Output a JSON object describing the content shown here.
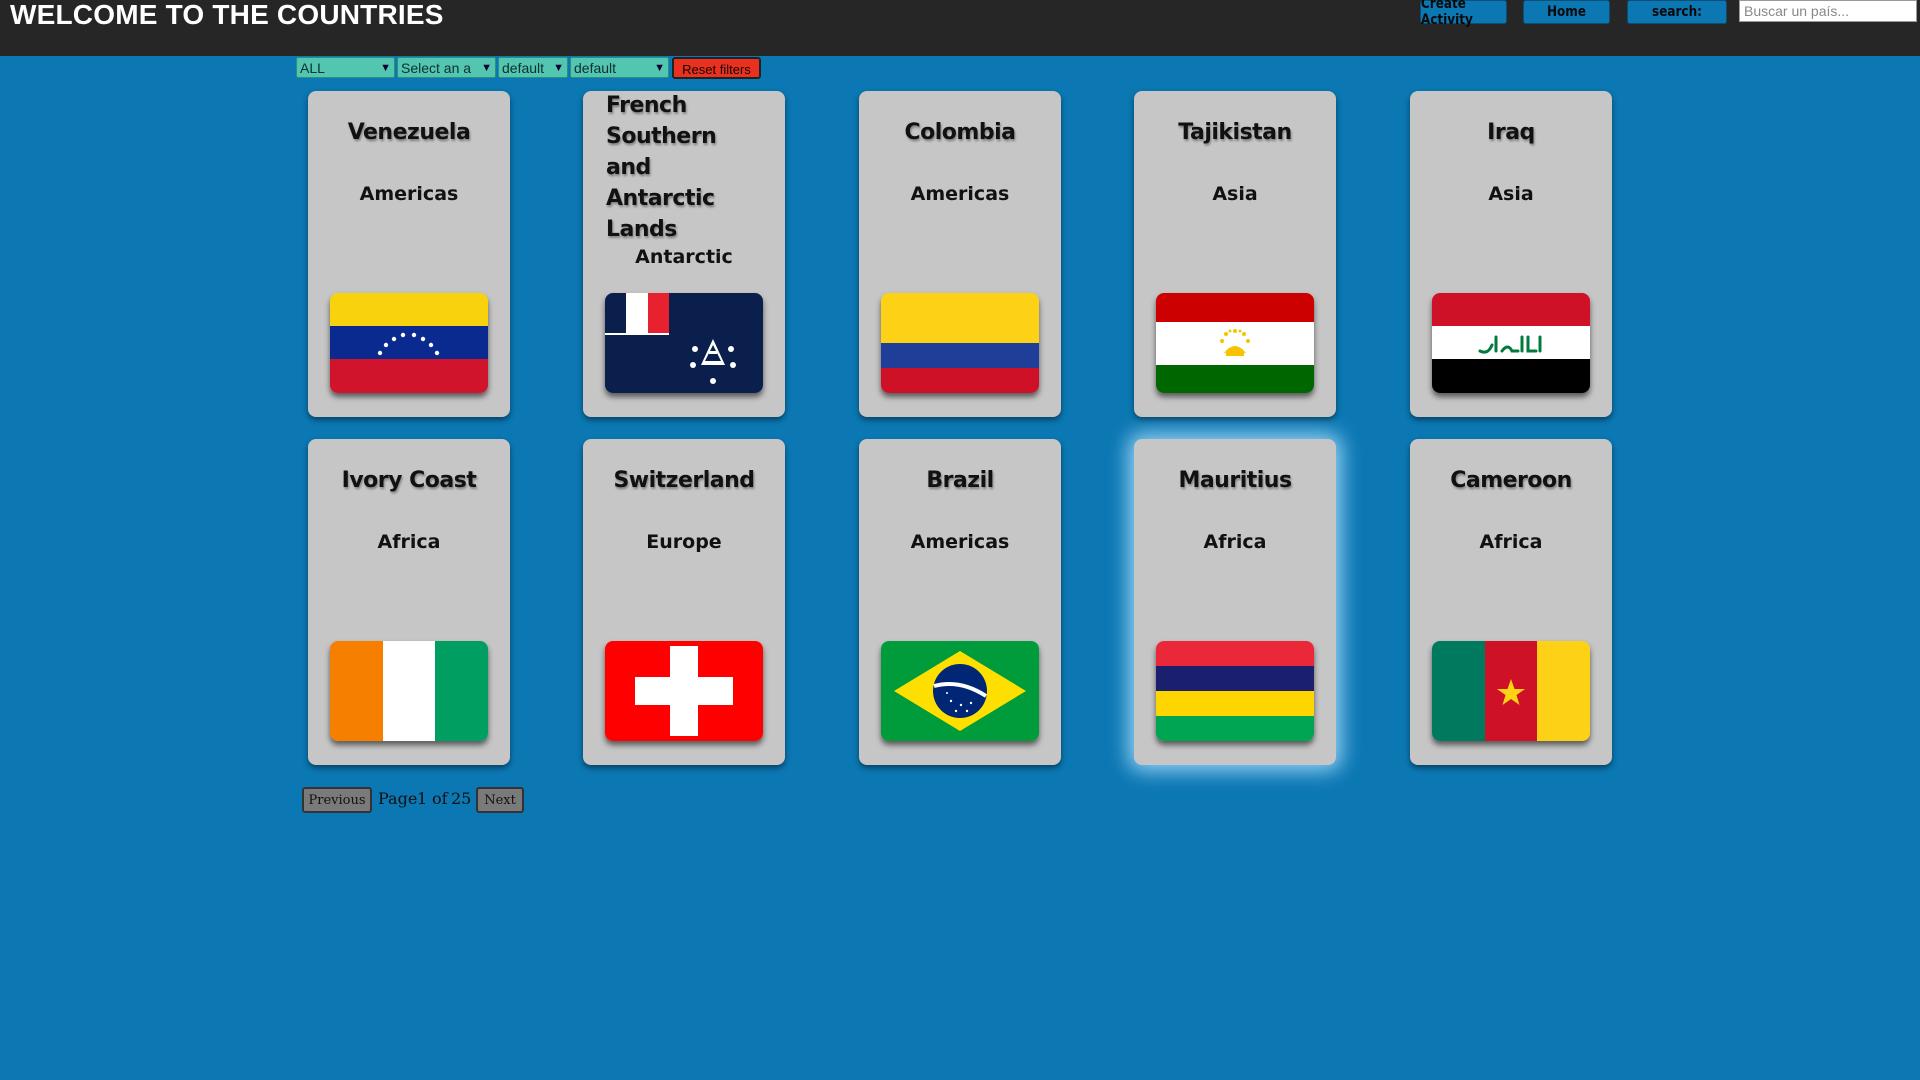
{
  "header": {
    "title": "WELCOME TO THE COUNTRIES",
    "nav": {
      "create_activity": "Create Activity",
      "home": "Home",
      "search_label": "search:"
    },
    "search": {
      "placeholder": "Buscar un país...",
      "value": ""
    }
  },
  "filters": {
    "continent": "ALL",
    "activity": "Select an a",
    "sort_alpha": "default",
    "sort_population": "default",
    "reset_label": "Reset filters"
  },
  "countries": [
    {
      "name": "Venezuela",
      "region": "Americas",
      "flag": "venezuela-flag"
    },
    {
      "name": "French Southern and Antarctic Lands",
      "name_lines": [
        "French",
        "Southern and",
        "Antarctic",
        "Lands"
      ],
      "region": "Antarctic",
      "flag": "french-southern-lands-flag"
    },
    {
      "name": "Colombia",
      "region": "Americas",
      "flag": "colombia-flag"
    },
    {
      "name": "Tajikistan",
      "region": "Asia",
      "flag": "tajikistan-flag"
    },
    {
      "name": "Iraq",
      "region": "Asia",
      "flag": "iraq-flag"
    },
    {
      "name": "Ivory Coast",
      "region": "Africa",
      "flag": "ivory-coast-flag"
    },
    {
      "name": "Switzerland",
      "region": "Europe",
      "flag": "switzerland-flag"
    },
    {
      "name": "Brazil",
      "region": "Americas",
      "flag": "brazil-flag"
    },
    {
      "name": "Mauritius",
      "region": "Africa",
      "flag": "mauritius-flag"
    },
    {
      "name": "Cameroon",
      "region": "Africa",
      "flag": "cameroon-flag"
    }
  ],
  "pagination": {
    "previous_label": "Previous",
    "page_word": "Page",
    "current_page": "1",
    "of_word": "of",
    "total_pages": "25",
    "next_label": "Next"
  },
  "colors": {
    "background": "#0b77b3",
    "header": "#262626",
    "card": "#c6c6c6",
    "filter": "#52c6b0",
    "reset": "#e8321f"
  }
}
